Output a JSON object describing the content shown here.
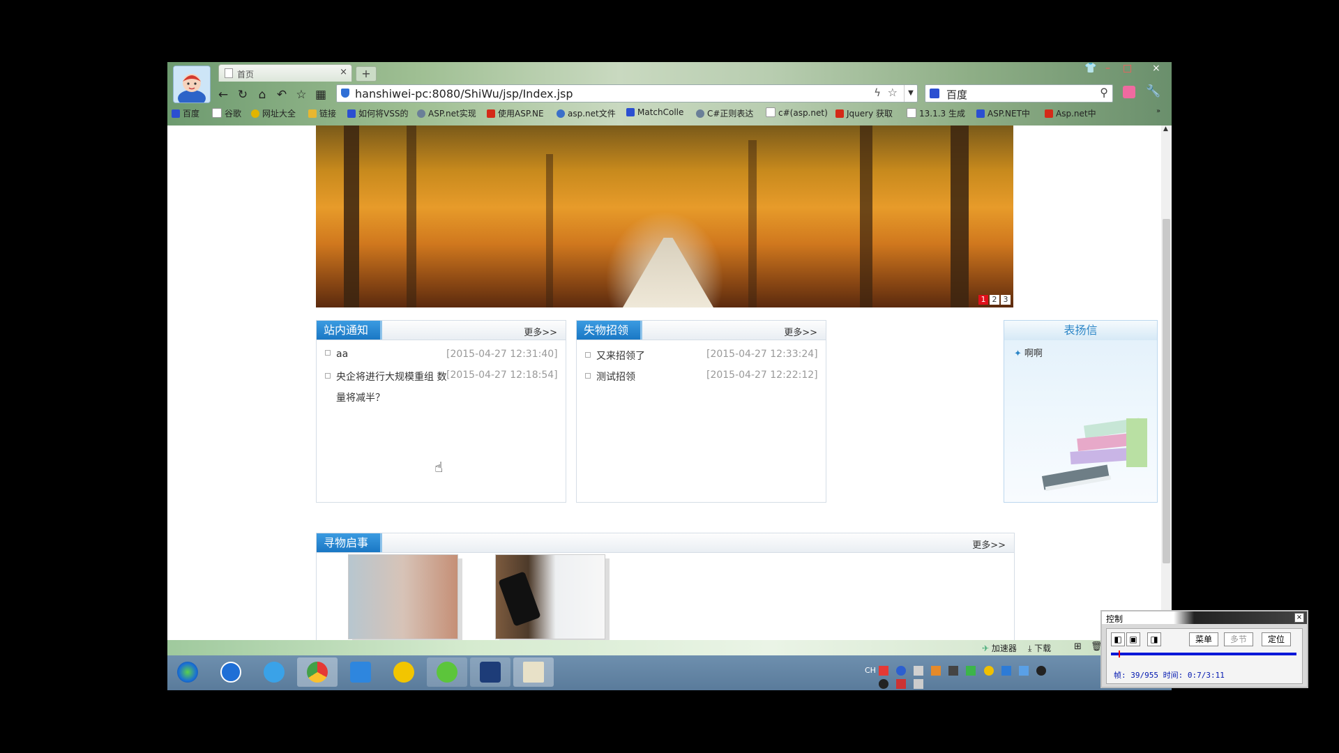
{
  "browser": {
    "tab_title": "首页",
    "tab_close": "×",
    "new_tab": "+",
    "url": "hanshiwei-pc:8080/ShiWu/jsp/Index.jsp",
    "search_engine": "百度",
    "window_controls": [
      "–",
      "□",
      "×"
    ],
    "bookmarks": [
      {
        "label": "百度",
        "color": "#2b4fd1"
      },
      {
        "label": "谷歌",
        "color": "#ffffff"
      },
      {
        "label": "网址大全",
        "color": "#e2b500"
      },
      {
        "label": "链接",
        "color": "#e8b730"
      },
      {
        "label": "如何将VSS的",
        "color": "#2b4fd1"
      },
      {
        "label": "ASP.net实现",
        "color": "#6a7f98"
      },
      {
        "label": "使用ASP.NE",
        "color": "#d42a18"
      },
      {
        "label": "asp.net文件",
        "color": "#3a6fc9"
      },
      {
        "label": "MatchColle",
        "color": "#2b4fd1"
      },
      {
        "label": "C#正则表达",
        "color": "#6a7f98"
      },
      {
        "label": "c#(asp.net)",
        "color": "#ffffff"
      },
      {
        "label": "Jquery 获取",
        "color": "#d42a18"
      },
      {
        "label": "13.1.3 生成",
        "color": "#ffffff"
      },
      {
        "label": "ASP.NET中",
        "color": "#2b4fd1"
      },
      {
        "label": "Asp.net中",
        "color": "#d42a18"
      }
    ],
    "statusbar": {
      "accelerator": "加速器",
      "download": "下载"
    }
  },
  "page": {
    "slider": {
      "numbers": [
        "1",
        "2",
        "3"
      ],
      "active_color": "#e0101a"
    },
    "notice": {
      "title": "站内通知",
      "more": "更多>>",
      "items": [
        {
          "text": "aa",
          "date": "[2015-04-27 12:31:40]"
        },
        {
          "text": "央企将进行大规模重组 数",
          "text2": "量将减半？",
          "date": "[2015-04-27 12:18:54]"
        }
      ]
    },
    "found": {
      "title": "失物招领",
      "more": "更多>>",
      "items": [
        {
          "text": "又来招领了",
          "date": "[2015-04-27 12:33:24]"
        },
        {
          "text": "测试招领",
          "date": "[2015-04-27 12:22:12]"
        }
      ]
    },
    "praise": {
      "title": "表扬信",
      "items": [
        "啊啊"
      ]
    },
    "lost": {
      "title": "寻物启事",
      "more": "更多>>"
    }
  },
  "taskbar": {
    "icons": [
      "windows-start-icon",
      "kugou-icon",
      "qq-browser-icon",
      "chrome-icon",
      "feige-icon",
      "sogou-icon",
      "green-app-icon",
      "s-app-icon",
      "screen-tool-icon"
    ],
    "tray_lang": "CH"
  },
  "control_panel": {
    "title": "控制",
    "close": "×",
    "buttons": [
      "菜单",
      "多节",
      "定位"
    ],
    "info": "帧: 39/955 时间: 0:7/3:11"
  }
}
